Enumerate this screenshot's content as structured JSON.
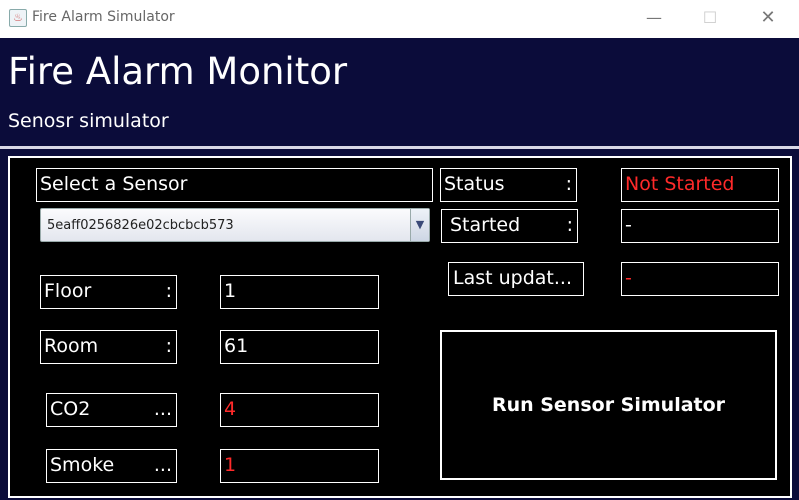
{
  "window": {
    "title": "Fire Alarm Simulator",
    "minimize": "—",
    "maximize": "☐",
    "close": "✕"
  },
  "header": {
    "title": "Fire Alarm Monitor",
    "subtitle": "Senosr simulator"
  },
  "sensor_select": {
    "label": "Select a Sensor",
    "selected": "5eaff0256826e02cbcbcb573"
  },
  "fields": {
    "floor": {
      "label": "Floor",
      "colon": ":",
      "value": "1"
    },
    "room": {
      "label": "Room",
      "colon": ":",
      "value": "61"
    },
    "co2": {
      "label": "CO2",
      "colon": "...",
      "value": "4"
    },
    "smoke": {
      "label": "Smoke",
      "colon": "...",
      "value": "1"
    }
  },
  "status": {
    "label": "Status",
    "colon": ":",
    "value": "Not Started",
    "started_label": "Started",
    "started_colon": ":",
    "started_value": "-",
    "last_update_label": "Last updat...",
    "last_update_value": "-"
  },
  "run_button": {
    "label": "Run Sensor Simulator"
  },
  "colors": {
    "header_bg": "#0b0c3a",
    "panel_bg": "#000000",
    "alert": "#ff2a2a"
  }
}
